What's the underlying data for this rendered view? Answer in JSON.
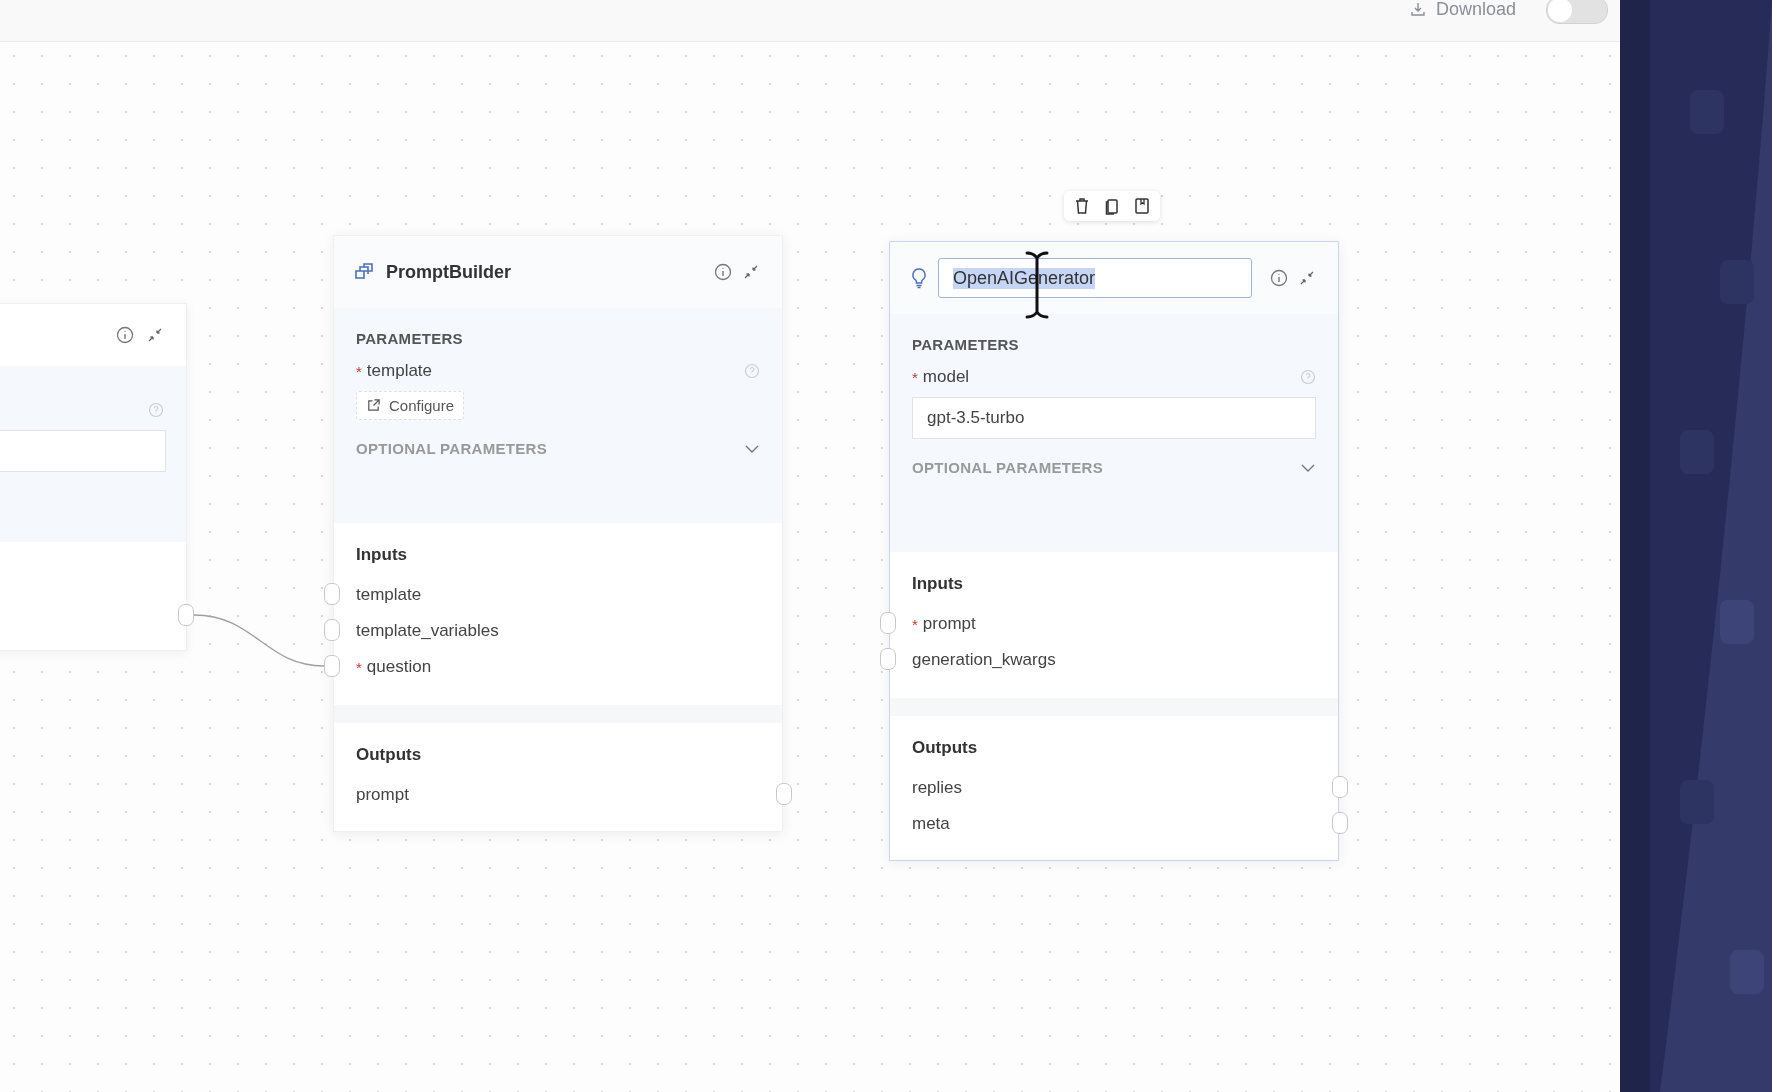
{
  "top_bar": {
    "download": "Download",
    "toggle": {
      "on": false
    }
  },
  "partial_node": {
    "selected": false
  },
  "nodes": [
    {
      "title": "PromptBuilder",
      "selected": false,
      "editing_title": false,
      "parameters_label": "PARAMETERS",
      "parameters": [
        {
          "marker": "*",
          "name": "template",
          "kind": "button",
          "button": "Configure"
        }
      ],
      "optional_label": "OPTIONAL PARAMETERS",
      "optional_expanded": false,
      "inputs_label": "Inputs",
      "inputs": [
        {
          "name": "template"
        },
        {
          "name": "template_variables"
        },
        {
          "marker": "*",
          "name": "question"
        }
      ],
      "outputs_label": "Outputs",
      "outputs": [
        {
          "name": "prompt"
        }
      ]
    },
    {
      "title": "OpenAIGenerator",
      "selected": true,
      "editing_title": true,
      "parameters_label": "PARAMETERS",
      "parameters": [
        {
          "marker": "*",
          "name": "model",
          "kind": "field",
          "value": "gpt-3.5-turbo"
        }
      ],
      "optional_label": "OPTIONAL PARAMETERS",
      "optional_expanded": false,
      "inputs_label": "Inputs",
      "inputs": [
        {
          "marker": "*",
          "name": "prompt"
        },
        {
          "name": "generation_kwargs"
        }
      ],
      "outputs_label": "Outputs",
      "outputs": [
        {
          "name": "replies"
        },
        {
          "name": "meta"
        }
      ]
    }
  ]
}
